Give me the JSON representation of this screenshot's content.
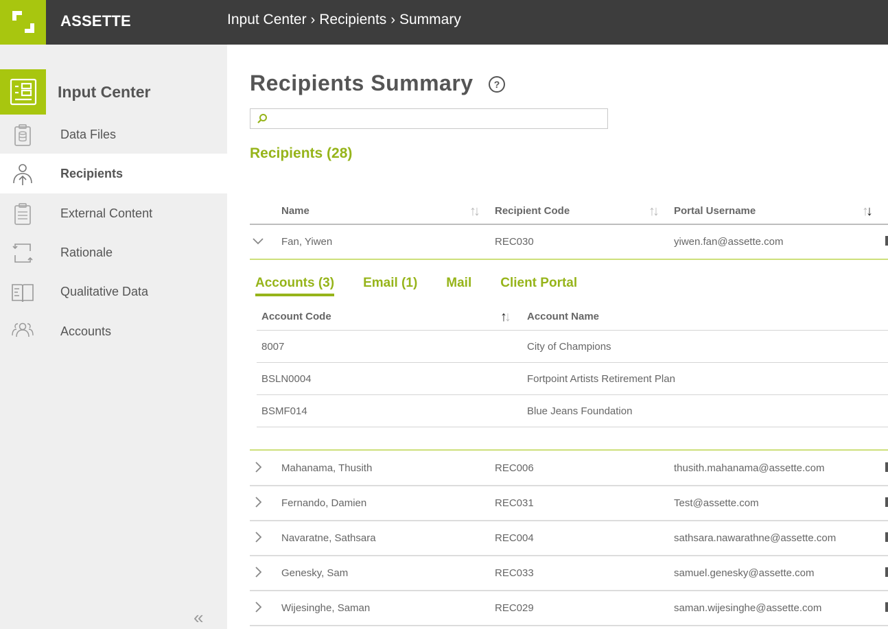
{
  "app": {
    "brand": "ASSETTE",
    "breadcrumb": [
      "Input Center",
      "Recipients",
      "Summary"
    ],
    "accent_color": "#a8c60f",
    "accent_text_color": "#96b41a",
    "topbar_color": "#3d3d3d"
  },
  "sidebar": {
    "header": {
      "label": "Input Center",
      "icon": "input-center-icon"
    },
    "items": [
      {
        "label": "Data Files",
        "icon": "clipboard-database-icon",
        "active": false
      },
      {
        "label": "Recipients",
        "icon": "person-upload-icon",
        "active": true
      },
      {
        "label": "External Content",
        "icon": "clipboard-list-icon",
        "active": false
      },
      {
        "label": "Rationale",
        "icon": "rationale-arrows-icon",
        "active": false
      },
      {
        "label": "Qualitative Data",
        "icon": "open-book-icon",
        "active": false
      },
      {
        "label": "Accounts",
        "icon": "people-group-icon",
        "active": false
      }
    ],
    "collapse_glyph": "«"
  },
  "main": {
    "title": "Recipients Summary",
    "help_glyph": "?",
    "search": {
      "value": "",
      "placeholder": ""
    },
    "section_title": "Recipients (28)",
    "columns": [
      "Name",
      "Recipient Code",
      "Portal Username"
    ],
    "rows": [
      {
        "name": "Fan, Yiwen",
        "code": "REC030",
        "username": "yiwen.fan@assette.com",
        "expanded": true
      },
      {
        "name": "Mahanama, Thusith",
        "code": "REC006",
        "username": "thusith.mahanama@assette.com",
        "expanded": false
      },
      {
        "name": "Fernando, Damien",
        "code": "REC031",
        "username": "Test@assette.com",
        "expanded": false
      },
      {
        "name": "Navaratne, Sathsara",
        "code": "REC004",
        "username": "sathsara.nawarathne@assette.com",
        "expanded": false
      },
      {
        "name": "Genesky, Sam",
        "code": "REC033",
        "username": "samuel.genesky@assette.com",
        "expanded": false
      },
      {
        "name": "Wijesinghe, Saman",
        "code": "REC029",
        "username": "saman.wijesinghe@assette.com",
        "expanded": false
      }
    ],
    "detail": {
      "tabs": [
        {
          "label": "Accounts (3)",
          "active": true
        },
        {
          "label": "Email (1)",
          "active": false
        },
        {
          "label": "Mail",
          "active": false
        },
        {
          "label": "Client Portal",
          "active": false
        }
      ],
      "columns": [
        "Account Code",
        "Account Name"
      ],
      "rows": [
        {
          "code": "8007",
          "name": "City of Champions"
        },
        {
          "code": "BSLN0004",
          "name": "Fortpoint Artists Retirement Plan"
        },
        {
          "code": "BSMF014",
          "name": "Blue Jeans Foundation"
        }
      ]
    }
  }
}
